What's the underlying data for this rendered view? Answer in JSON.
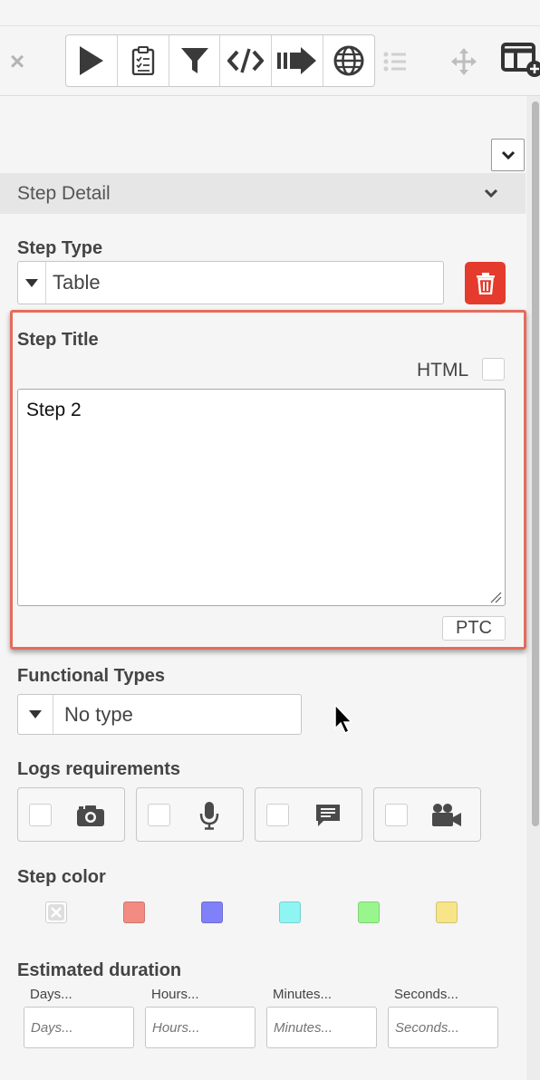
{
  "toolbar": {
    "close_icon": "close-icon",
    "buttons": [
      {
        "name": "play-icon"
      },
      {
        "name": "clipboard-check-icon"
      },
      {
        "name": "filter-icon"
      },
      {
        "name": "code-icon"
      },
      {
        "name": "arrow-right-icon"
      },
      {
        "name": "globe-icon"
      }
    ],
    "extras": [
      "list-icon",
      "move-icon",
      "add-layout-icon"
    ]
  },
  "step_detail": {
    "header": "Step Detail",
    "step_type_label": "Step Type",
    "step_type_value": "Table",
    "step_title_label": "Step Title",
    "html_label": "HTML",
    "step_title_value": "Step 2",
    "ptc_label": "PTC",
    "functional_types_label": "Functional Types",
    "functional_types_value": "No type",
    "logs_label": "Logs requirements",
    "logs": [
      "camera-icon",
      "microphone-icon",
      "comment-icon",
      "video-camera-icon"
    ],
    "step_color_label": "Step color",
    "colors": [
      "none",
      "#f28b82",
      "#8080f8",
      "#8ff5f3",
      "#99f68c",
      "#f8e58a"
    ],
    "duration_label": "Estimated duration",
    "duration_fields": [
      {
        "label": "Days...",
        "placeholder": "Days..."
      },
      {
        "label": "Hours...",
        "placeholder": "Hours..."
      },
      {
        "label": "Minutes...",
        "placeholder": "Minutes..."
      },
      {
        "label": "Seconds...",
        "placeholder": "Seconds..."
      }
    ]
  }
}
